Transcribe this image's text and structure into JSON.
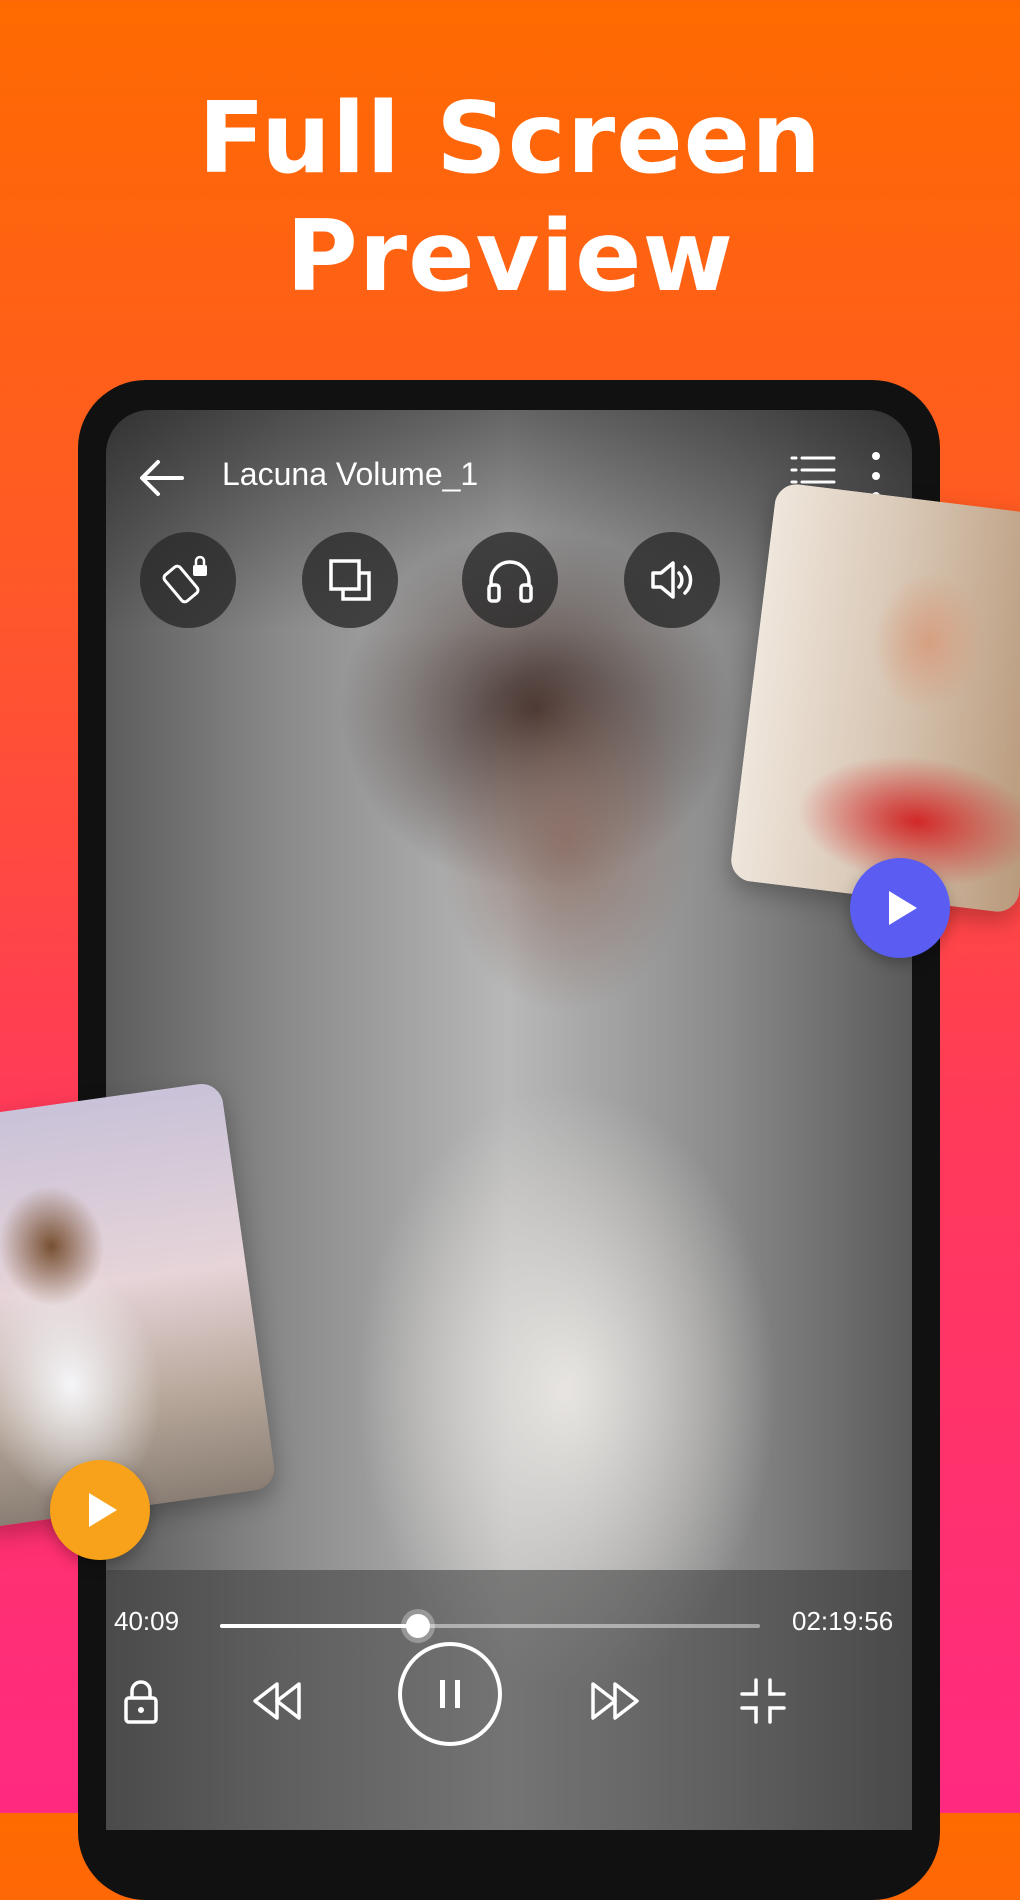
{
  "headline": {
    "line1": "Full Screen",
    "line2": "Preview"
  },
  "player": {
    "title": "Lacuna Volume_1",
    "current_time": "40:09",
    "total_time": "02:19:56",
    "progress": 0.366
  },
  "top_controls": [
    "rotate-lock-icon",
    "pip-icon",
    "headphones-icon",
    "volume-icon"
  ],
  "bottom_controls": [
    "lock-icon",
    "rewind-icon",
    "pause-icon",
    "fast-forward-icon",
    "exit-fullscreen-icon"
  ],
  "colors": {
    "gradient_top": "#ff6a00",
    "gradient_bottom": "#ff2a80",
    "right_play_badge": "#5a5cf2",
    "left_play_badge": "#f7a21a"
  }
}
